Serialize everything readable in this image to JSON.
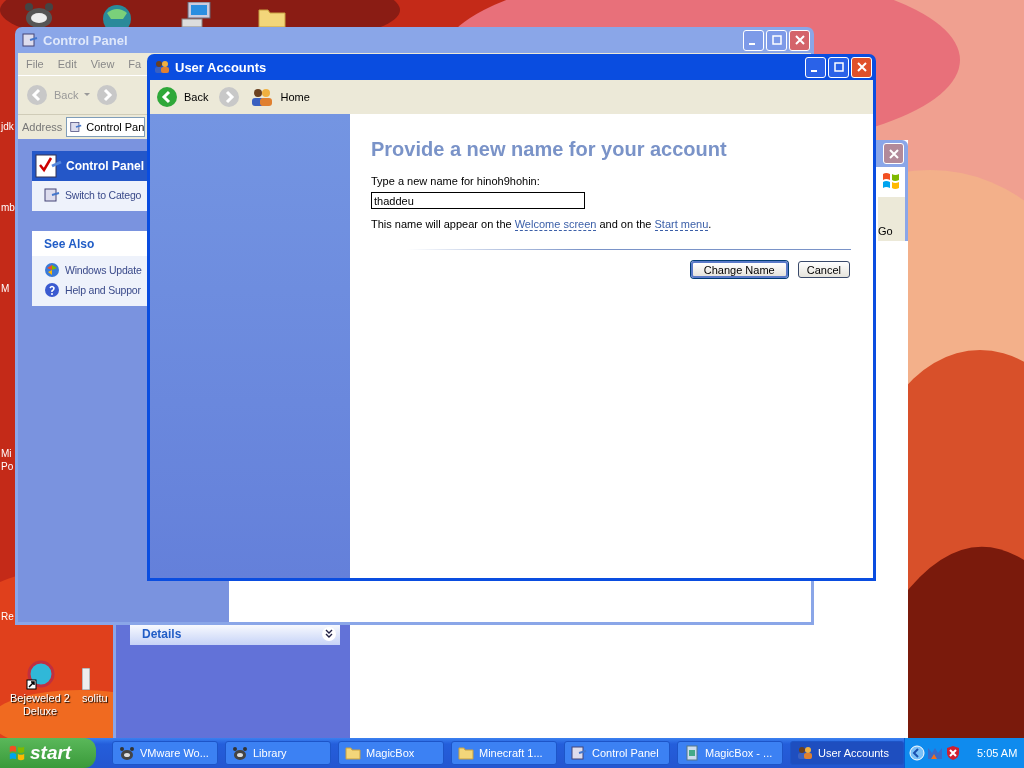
{
  "desktop": {
    "edge_labels": [
      "jdk",
      "mb",
      "M",
      "Mi",
      "Po",
      "Re"
    ],
    "icons": [
      {
        "label": "Bejeweled 2 Deluxe"
      },
      {
        "label": "solitu"
      }
    ]
  },
  "back_window": {
    "go_button": "Go",
    "details_panel": "Details"
  },
  "control_panel": {
    "title": "Control Panel",
    "active": false,
    "menu": [
      "File",
      "Edit",
      "View",
      "Fa"
    ],
    "back": "Back",
    "address_label": "Address",
    "address": "Control Pan",
    "task_panel": {
      "title": "Control Panel",
      "items": [
        "Switch to Catego"
      ]
    },
    "see_also": {
      "title": "See Also",
      "items": [
        "Windows Update",
        "Help and Suppor"
      ]
    }
  },
  "user_accounts": {
    "title": "User Accounts",
    "active": true,
    "toolbar": {
      "back": "Back",
      "home": "Home"
    },
    "heading": "Provide a new name for your account",
    "prompt": "Type a new name for hinoh9hohin:",
    "name_field": {
      "value": "thaddeu"
    },
    "note": [
      {
        "kind": "text",
        "text": "This name will appear on the "
      },
      {
        "kind": "link",
        "text": "Welcome screen"
      },
      {
        "kind": "text",
        "text": " and on the "
      },
      {
        "kind": "link",
        "text": "Start menu"
      },
      {
        "kind": "text",
        "text": "."
      }
    ],
    "buttons": [
      {
        "label": "Change Name",
        "default": true
      },
      {
        "label": "Cancel",
        "default": false
      }
    ]
  },
  "taskbar": {
    "start": "start",
    "items": [
      {
        "label": "VMware Wo...",
        "selected": false
      },
      {
        "label": "Library",
        "selected": false
      },
      {
        "label": "MagicBox",
        "selected": false
      },
      {
        "label": "Minecraft 1...",
        "selected": false
      },
      {
        "label": "Control Panel",
        "selected": false
      },
      {
        "label": "MagicBox - ...",
        "selected": false
      },
      {
        "label": "User Accounts",
        "selected": true
      }
    ],
    "clock": "5:05 AM"
  }
}
